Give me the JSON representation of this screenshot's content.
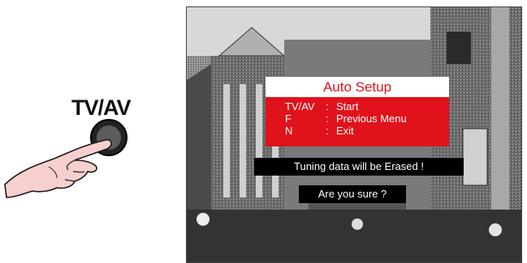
{
  "remote": {
    "button_label": "TV/AV",
    "icons": [
      "pressing-hand-icon",
      "round-button-icon"
    ]
  },
  "osd": {
    "title": "Auto Setup",
    "items": [
      {
        "key": "TV/AV",
        "sep": ":",
        "action": "Start"
      },
      {
        "key": "F",
        "sep": ":",
        "action": "Previous Menu"
      },
      {
        "key": "N",
        "sep": ":",
        "action": "Exit"
      }
    ],
    "warning": "Tuning data will be Erased !",
    "confirm": "Are you sure ?"
  },
  "colors": {
    "menu_red": "#e0121b",
    "bar_black": "#000000",
    "text_white": "#ffffff"
  }
}
